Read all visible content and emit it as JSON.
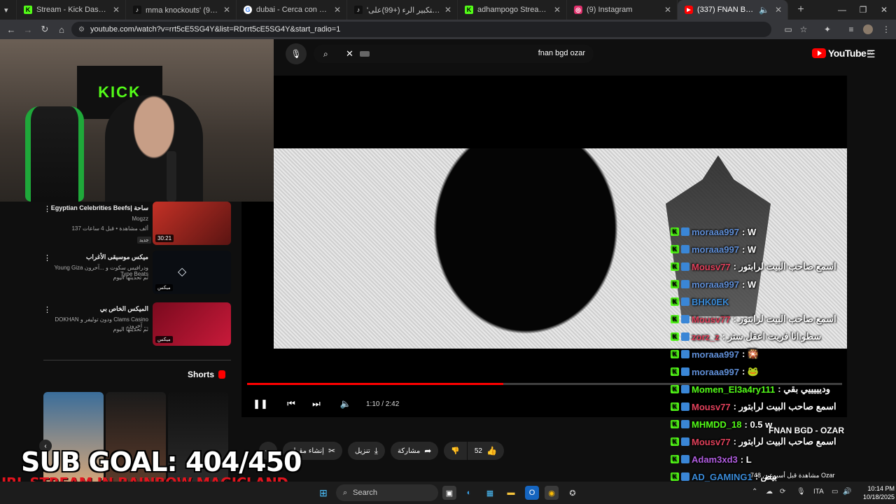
{
  "browser": {
    "tabs": [
      {
        "label": "Stream - Kick Dashboard",
        "favicon": "kick-icon",
        "color": "#53fc18"
      },
      {
        "label": "mma knockouts' على(+99)",
        "favicon": "tiktok-icon",
        "color": "#111111"
      },
      {
        "label": "dubai - Cerca con Google",
        "favicon": "google-icon",
        "color": "#4285f4"
      },
      {
        "label": "'تمرين لتكبير الرء (+99)على",
        "favicon": "tiktok-icon",
        "color": "#111111"
      },
      {
        "label": "adhampogo Stream - Watch Li",
        "favicon": "kick-icon",
        "color": "#53fc18"
      },
      {
        "label": "(9) Instagram",
        "favicon": "instagram-icon",
        "color": "#e1306c"
      },
      {
        "label": "(337) FNAN BGD - OZAR",
        "favicon": "youtube-icon",
        "color": "#ff0000"
      }
    ],
    "url": "youtube.com/watch?v=rrt5cE5SG4Y&list=RDrrt5cE5SG4Y&start_radio=1"
  },
  "youtube": {
    "search_query": "fnan bgd ozar",
    "logo": "YouTube",
    "region": "EG",
    "player": {
      "time": "1:10 / 2:42",
      "progress_fraction": 0.43
    },
    "actions": {
      "clip": "إنشاء مقطع",
      "download": "تنزيل",
      "share": "مشاركة",
      "likes": "52"
    },
    "recs": [
      {
        "title": "Egyptian Celebrities Beefs| ساحة",
        "channel": "Mogzz",
        "meta": "137 ألف مشاهدة • قبل 4 ساعات",
        "duration": "30:21",
        "badge": "جديد",
        "thumb_color": "#b02a25"
      },
      {
        "title": "ميكس موسيقى الأغراب",
        "channel": "Young Giza ودرافيس سكوت و ...آخرون Type Beats",
        "meta": "تم تحديثها اليوم",
        "duration": "ميكس",
        "badge": "",
        "thumb_color": "#0a0d12"
      },
      {
        "title": "الميكس الخاص بي",
        "channel": "DOKHAN ودون توليفر و Clams Casino آخرون ...",
        "meta": "تم تحديثها اليوم",
        "duration": "ميكس",
        "badge": "",
        "thumb_color": "#9b0f2a"
      }
    ],
    "shorts_heading": "Shorts",
    "views": "748 مشاهدة قبل أسبوعين Ozar"
  },
  "overlay": {
    "sub_goal": "SUB GOAL: 404/450",
    "irl_banner": "IRL STREAM IN RAINBOW MAGICLAND",
    "stream_title": "FNAN BGD - OZAR",
    "chat": [
      {
        "user": "moraaa997",
        "msg": ": W",
        "color": "#5f8ed6"
      },
      {
        "user": "moraaa997",
        "msg": ": W",
        "color": "#5f8ed6"
      },
      {
        "user": "Mousv77",
        "msg": ": اسمع صاحب البيت لرابتور",
        "color": "#e0405a"
      },
      {
        "user": "moraaa997",
        "msg": ": W",
        "color": "#5f8ed6"
      },
      {
        "user": "BHK0EK",
        "msg": "",
        "color": "#3a8bd8"
      },
      {
        "user": "Mousv77",
        "msg": ": اسمع صاحب البيت لرابتور",
        "color": "#e0405a"
      },
      {
        "user": "zorz_z",
        "msg": ": سطو انا فريت اعقل ستر",
        "color": "#e0405a"
      },
      {
        "user": "moraaa997",
        "msg": ": 🎇",
        "color": "#5f8ed6"
      },
      {
        "user": "moraaa997",
        "msg": ": 🐸",
        "color": "#5f8ed6"
      },
      {
        "user": "Momen_El3a4ry111",
        "msg": ": وديييييي بقي",
        "color": "#53fc18"
      },
      {
        "user": "Mousv77",
        "msg": ": اسمع صاحب البيت لرابتور",
        "color": "#e0405a"
      },
      {
        "user": "MHMDD_18",
        "msg": ": 0.5 w",
        "color": "#53fc18"
      },
      {
        "user": "Mousv77",
        "msg": ": اسمع صاحب البيت لرابتور",
        "color": "#e0405a"
      },
      {
        "user": "Adam3xd3",
        "msg": ": L",
        "color": "#b15de0"
      },
      {
        "user": "AD_GAMING1",
        "msg": ": بيض",
        "color": "#3a8bd8"
      }
    ]
  },
  "taskbar": {
    "search_placeholder": "Search",
    "lang": "ITA",
    "time": "10:14 PM",
    "date": "10/18/2025"
  }
}
